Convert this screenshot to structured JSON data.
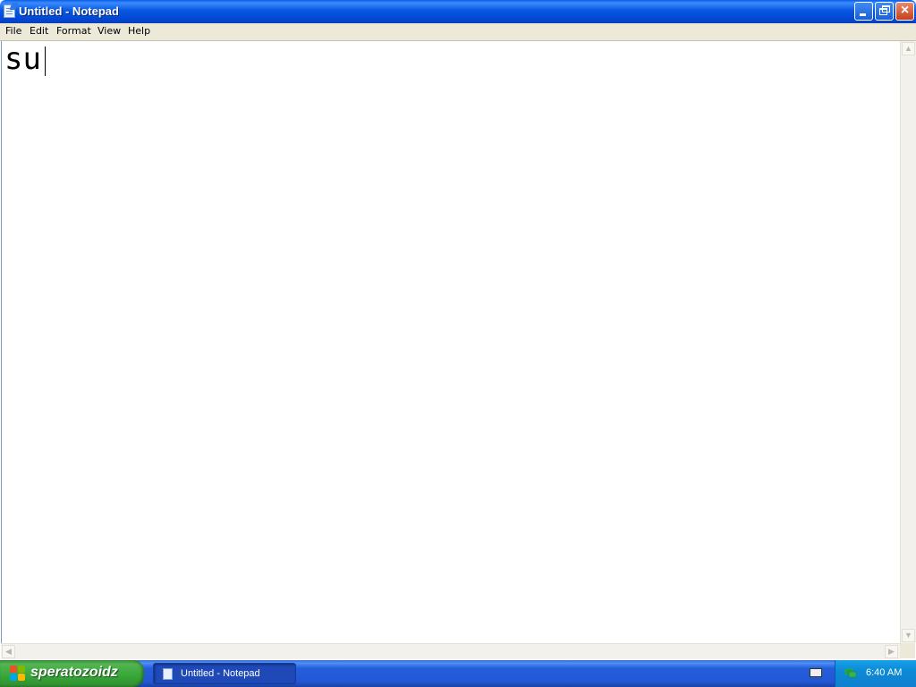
{
  "window": {
    "title": "Untitled - Notepad",
    "buttons": {
      "minimize": "minimize",
      "maximize": "restore",
      "close": "×"
    }
  },
  "menubar": {
    "items": [
      "File",
      "Edit",
      "Format",
      "View",
      "Help"
    ]
  },
  "editor": {
    "content": "su"
  },
  "scrollbars": {
    "up": "▲",
    "down": "▼",
    "left": "◀",
    "right": "▶"
  },
  "taskbar": {
    "start_label": "speratozoidz",
    "task_label": "Untitled - Notepad",
    "clock": "6:40 AM"
  },
  "colors": {
    "titlebar": "#0858e0",
    "menubar": "#ece9d8",
    "taskbar": "#245edb",
    "start": "#37a637",
    "tray": "#0f7fcf"
  },
  "icons": {
    "app": "notepad-icon",
    "start": "windows-logo-icon",
    "keyboard": "keyboard-icon",
    "network": "network-icon"
  }
}
